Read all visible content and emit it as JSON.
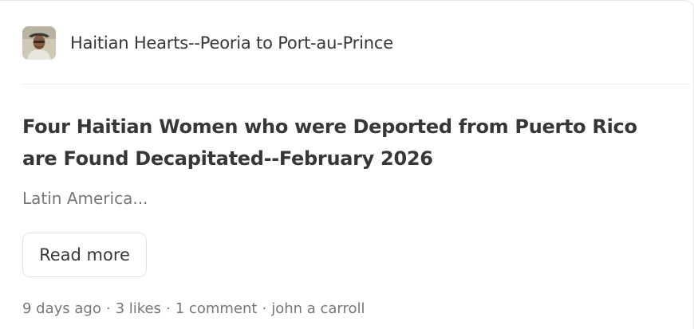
{
  "publication": {
    "name": "Haitian Hearts--Peoria to Port-au-Prince",
    "avatar_icon": "author-photo"
  },
  "post": {
    "title": "Four Haitian Women who were Deported from Puerto Rico are Found Decapitated--February 2026",
    "subtitle": "Latin America...",
    "read_more_label": "Read more"
  },
  "meta": {
    "age": "9 days ago",
    "likes": "3 likes",
    "comments": "1 comment",
    "author": "john a carroll",
    "separator": "·"
  },
  "colors": {
    "text": "#363737",
    "muted": "#77777a",
    "border": "#e6e6e6"
  }
}
